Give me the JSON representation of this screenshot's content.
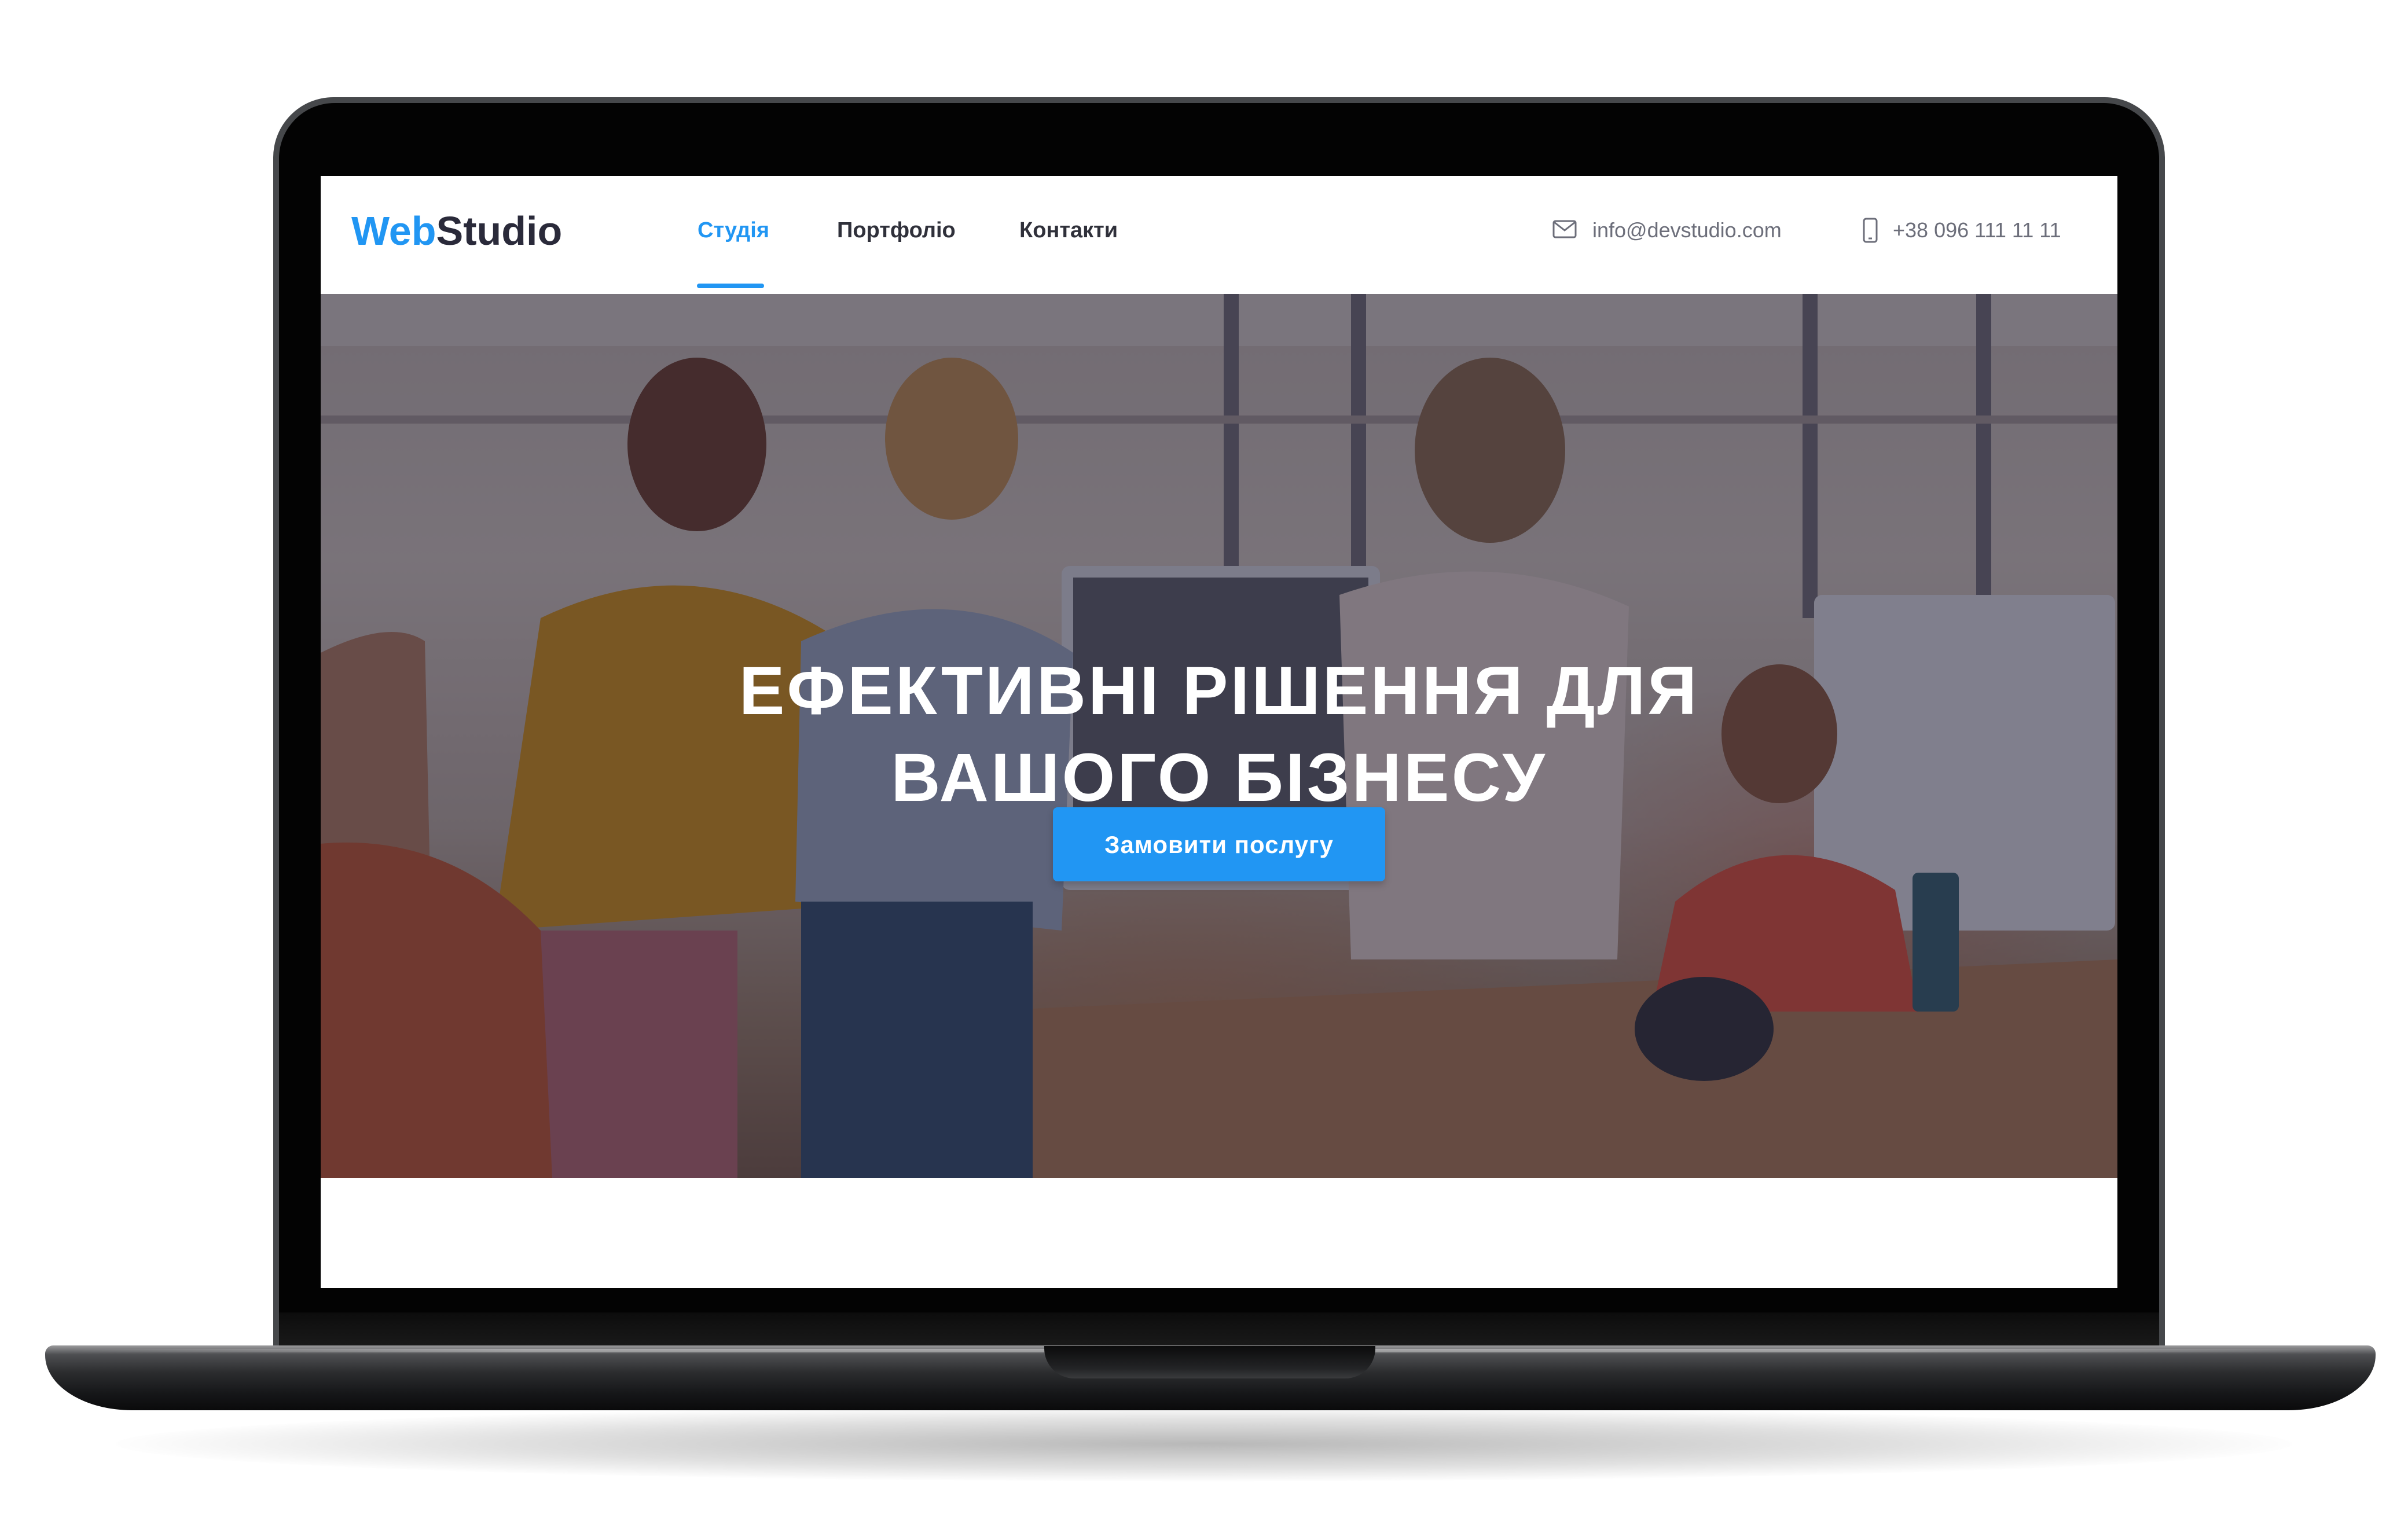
{
  "site": {
    "logo": {
      "part1": "Web",
      "part2": "Studio"
    },
    "nav": [
      {
        "label": "Студія",
        "active": true
      },
      {
        "label": "Портфоліо",
        "active": false
      },
      {
        "label": "Контакти",
        "active": false
      }
    ],
    "contacts": {
      "email": "info@devstudio.com",
      "phone": "+38 096 111 11 11",
      "email_icon": "mail-icon",
      "phone_icon": "smartphone-icon"
    }
  },
  "hero": {
    "title_line1": "Ефективні рішення для",
    "title_line2": "вашого бізнесу",
    "cta_label": "Замовити послугу"
  },
  "colors": {
    "accent": "#2196f3",
    "dark_text": "#2a2a3a",
    "muted_text": "#6c6e7a"
  }
}
